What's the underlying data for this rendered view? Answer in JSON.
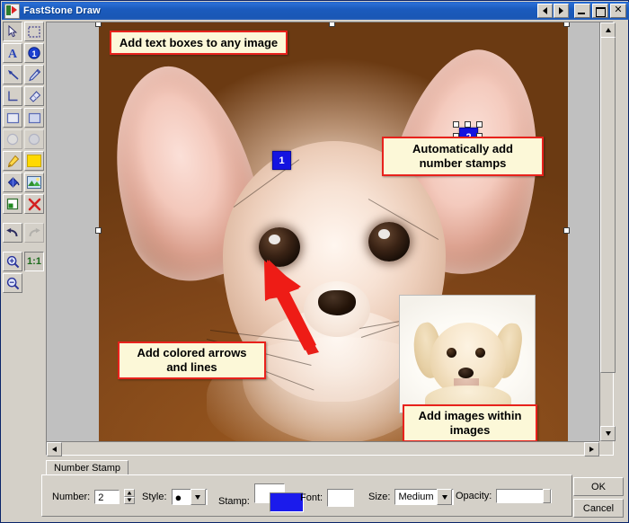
{
  "window": {
    "title": "FastStone Draw",
    "icon": "app-icon",
    "nav_prev": "◀",
    "nav_next": "▶",
    "minimize": "_",
    "maximize": "□",
    "close": "✕"
  },
  "toolbar": {
    "tools": [
      {
        "name": "select-pointer-icon",
        "label": "Select",
        "state": "active"
      },
      {
        "name": "marquee-select-icon",
        "label": "Marquee Select",
        "state": "normal"
      },
      {
        "name": "text-tool-icon",
        "label": "Text",
        "state": "normal"
      },
      {
        "name": "number-stamp-icon",
        "label": "Number Stamp",
        "state": "normal"
      },
      {
        "name": "arrow-tool-icon",
        "label": "Arrow",
        "state": "normal"
      },
      {
        "name": "pencil-tool-icon",
        "label": "Pencil",
        "state": "normal"
      },
      {
        "name": "line-tool-icon",
        "label": "Line",
        "state": "normal"
      },
      {
        "name": "eraser-tool-icon",
        "label": "Eraser",
        "state": "normal"
      },
      {
        "name": "rectangle-tool-icon",
        "label": "Rectangle",
        "state": "normal"
      },
      {
        "name": "filled-rectangle-tool-icon",
        "label": "Filled Rectangle",
        "state": "normal"
      },
      {
        "name": "ellipse-tool-icon",
        "label": "Ellipse",
        "state": "disabled"
      },
      {
        "name": "filled-ellipse-tool-icon",
        "label": "Filled Ellipse",
        "state": "disabled"
      },
      {
        "name": "highlighter-tool-icon",
        "label": "Highlighter",
        "state": "normal"
      },
      {
        "name": "fill-color-icon",
        "label": "Fill Color",
        "state": "normal"
      },
      {
        "name": "paint-bucket-icon",
        "label": "Paint Bucket",
        "state": "normal"
      },
      {
        "name": "insert-image-icon",
        "label": "Insert Image",
        "state": "normal"
      },
      {
        "name": "crop-icon",
        "label": "Crop",
        "state": "normal"
      },
      {
        "name": "delete-icon",
        "label": "Delete",
        "state": "normal"
      },
      {
        "name": "undo-icon",
        "label": "Undo",
        "state": "normal"
      },
      {
        "name": "redo-icon",
        "label": "Redo",
        "state": "disabled"
      },
      {
        "name": "zoom-in-icon",
        "label": "Zoom In",
        "state": "normal"
      },
      {
        "name": "actual-size-icon",
        "label": "1:1",
        "state": "normal"
      },
      {
        "name": "zoom-out-icon",
        "label": "Zoom Out",
        "state": "normal"
      }
    ],
    "actual_size_label": "1:1"
  },
  "canvas": {
    "callouts": [
      {
        "id": "callout-text-boxes",
        "text": "Add text boxes to any image"
      },
      {
        "id": "callout-number-stamps",
        "text": "Automatically add\nnumber stamps"
      },
      {
        "id": "callout-arrows",
        "text": "Add colored arrows\nand lines"
      },
      {
        "id": "callout-images",
        "text": "Add images within\nimages"
      }
    ],
    "stamps": [
      {
        "id": "stamp-1",
        "value": "1",
        "selected": false
      },
      {
        "id": "stamp-2",
        "value": "2",
        "selected": true
      }
    ],
    "annotation_colors": {
      "callout_fill": "#fcf8d8",
      "callout_border": "#e8221c",
      "stamp_fill": "#1414e0",
      "stamp_text": "#ffffff",
      "arrow": "#e8201a"
    }
  },
  "panel": {
    "tab": "Number Stamp",
    "fields": {
      "number_label": "Number:",
      "number_value": "2",
      "style_label": "Style:",
      "style_value": "●",
      "stamp_label": "Stamp:",
      "stamp_color_text": "#ffffff",
      "stamp_color_fill": "#1b1bec",
      "font_label": "Font:",
      "font_color": "#ffffff",
      "size_label": "Size:",
      "size_value": "Medium",
      "opacity_label": "Opacity:",
      "opacity_value": "100"
    },
    "buttons": {
      "ok": "OK",
      "cancel": "Cancel"
    }
  }
}
